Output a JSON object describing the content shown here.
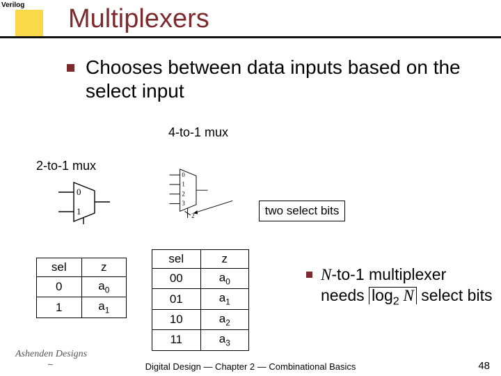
{
  "slide": {
    "tag": "Verilog",
    "title": "Multiplexers",
    "main_bullet": "Chooses between data inputs based on the select input",
    "label_4to1": "4-to-1 mux",
    "label_2to1": "2-to-1 mux",
    "two_select_label": "two select bits",
    "footer": "Digital Design — Chapter 2 — Combinational Basics",
    "page": "48",
    "logo": "Ashenden Designs"
  },
  "mux2_diagram": {
    "in_top": "0",
    "in_bot": "1"
  },
  "mux4_diagram": {
    "in0": "0",
    "in1": "1",
    "in2": "2",
    "in3": "3",
    "sel_width": "2"
  },
  "table2": {
    "head": {
      "sel": "sel",
      "z": "z"
    },
    "rows": [
      {
        "sel": "0",
        "z_base": "a",
        "z_sub": "0"
      },
      {
        "sel": "1",
        "z_base": "a",
        "z_sub": "1"
      }
    ]
  },
  "table4": {
    "head": {
      "sel": "sel",
      "z": "z"
    },
    "rows": [
      {
        "sel": "00",
        "z_base": "a",
        "z_sub": "0"
      },
      {
        "sel": "01",
        "z_base": "a",
        "z_sub": "1"
      },
      {
        "sel": "10",
        "z_base": "a",
        "z_sub": "2"
      },
      {
        "sel": "11",
        "z_base": "a",
        "z_sub": "3"
      }
    ]
  },
  "right_point": {
    "pre": "N",
    "mid1": "-to-1 multiplexer needs ",
    "log": "log",
    "base": "2",
    "var": " N",
    "post": " select bits"
  }
}
